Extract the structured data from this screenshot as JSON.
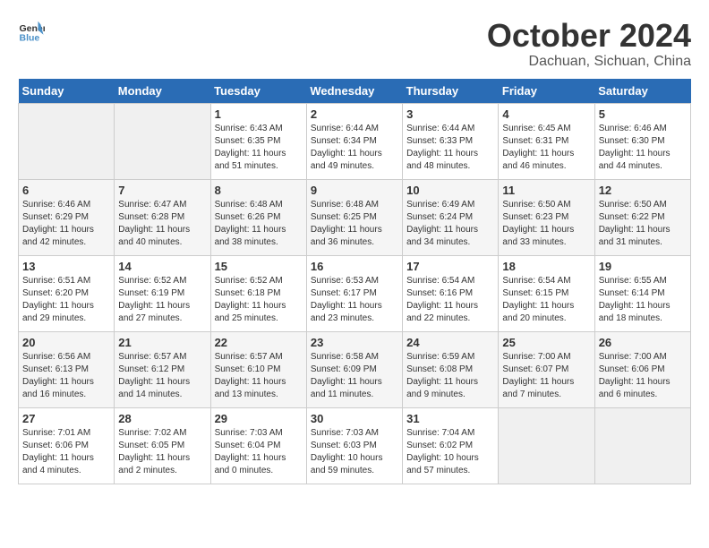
{
  "header": {
    "logo_line1": "General",
    "logo_line2": "Blue",
    "month_title": "October 2024",
    "location": "Dachuan, Sichuan, China"
  },
  "days_of_week": [
    "Sunday",
    "Monday",
    "Tuesday",
    "Wednesday",
    "Thursday",
    "Friday",
    "Saturday"
  ],
  "weeks": [
    [
      {
        "day": "",
        "info": ""
      },
      {
        "day": "",
        "info": ""
      },
      {
        "day": "1",
        "info": "Sunrise: 6:43 AM\nSunset: 6:35 PM\nDaylight: 11 hours and 51 minutes."
      },
      {
        "day": "2",
        "info": "Sunrise: 6:44 AM\nSunset: 6:34 PM\nDaylight: 11 hours and 49 minutes."
      },
      {
        "day": "3",
        "info": "Sunrise: 6:44 AM\nSunset: 6:33 PM\nDaylight: 11 hours and 48 minutes."
      },
      {
        "day": "4",
        "info": "Sunrise: 6:45 AM\nSunset: 6:31 PM\nDaylight: 11 hours and 46 minutes."
      },
      {
        "day": "5",
        "info": "Sunrise: 6:46 AM\nSunset: 6:30 PM\nDaylight: 11 hours and 44 minutes."
      }
    ],
    [
      {
        "day": "6",
        "info": "Sunrise: 6:46 AM\nSunset: 6:29 PM\nDaylight: 11 hours and 42 minutes."
      },
      {
        "day": "7",
        "info": "Sunrise: 6:47 AM\nSunset: 6:28 PM\nDaylight: 11 hours and 40 minutes."
      },
      {
        "day": "8",
        "info": "Sunrise: 6:48 AM\nSunset: 6:26 PM\nDaylight: 11 hours and 38 minutes."
      },
      {
        "day": "9",
        "info": "Sunrise: 6:48 AM\nSunset: 6:25 PM\nDaylight: 11 hours and 36 minutes."
      },
      {
        "day": "10",
        "info": "Sunrise: 6:49 AM\nSunset: 6:24 PM\nDaylight: 11 hours and 34 minutes."
      },
      {
        "day": "11",
        "info": "Sunrise: 6:50 AM\nSunset: 6:23 PM\nDaylight: 11 hours and 33 minutes."
      },
      {
        "day": "12",
        "info": "Sunrise: 6:50 AM\nSunset: 6:22 PM\nDaylight: 11 hours and 31 minutes."
      }
    ],
    [
      {
        "day": "13",
        "info": "Sunrise: 6:51 AM\nSunset: 6:20 PM\nDaylight: 11 hours and 29 minutes."
      },
      {
        "day": "14",
        "info": "Sunrise: 6:52 AM\nSunset: 6:19 PM\nDaylight: 11 hours and 27 minutes."
      },
      {
        "day": "15",
        "info": "Sunrise: 6:52 AM\nSunset: 6:18 PM\nDaylight: 11 hours and 25 minutes."
      },
      {
        "day": "16",
        "info": "Sunrise: 6:53 AM\nSunset: 6:17 PM\nDaylight: 11 hours and 23 minutes."
      },
      {
        "day": "17",
        "info": "Sunrise: 6:54 AM\nSunset: 6:16 PM\nDaylight: 11 hours and 22 minutes."
      },
      {
        "day": "18",
        "info": "Sunrise: 6:54 AM\nSunset: 6:15 PM\nDaylight: 11 hours and 20 minutes."
      },
      {
        "day": "19",
        "info": "Sunrise: 6:55 AM\nSunset: 6:14 PM\nDaylight: 11 hours and 18 minutes."
      }
    ],
    [
      {
        "day": "20",
        "info": "Sunrise: 6:56 AM\nSunset: 6:13 PM\nDaylight: 11 hours and 16 minutes."
      },
      {
        "day": "21",
        "info": "Sunrise: 6:57 AM\nSunset: 6:12 PM\nDaylight: 11 hours and 14 minutes."
      },
      {
        "day": "22",
        "info": "Sunrise: 6:57 AM\nSunset: 6:10 PM\nDaylight: 11 hours and 13 minutes."
      },
      {
        "day": "23",
        "info": "Sunrise: 6:58 AM\nSunset: 6:09 PM\nDaylight: 11 hours and 11 minutes."
      },
      {
        "day": "24",
        "info": "Sunrise: 6:59 AM\nSunset: 6:08 PM\nDaylight: 11 hours and 9 minutes."
      },
      {
        "day": "25",
        "info": "Sunrise: 7:00 AM\nSunset: 6:07 PM\nDaylight: 11 hours and 7 minutes."
      },
      {
        "day": "26",
        "info": "Sunrise: 7:00 AM\nSunset: 6:06 PM\nDaylight: 11 hours and 6 minutes."
      }
    ],
    [
      {
        "day": "27",
        "info": "Sunrise: 7:01 AM\nSunset: 6:06 PM\nDaylight: 11 hours and 4 minutes."
      },
      {
        "day": "28",
        "info": "Sunrise: 7:02 AM\nSunset: 6:05 PM\nDaylight: 11 hours and 2 minutes."
      },
      {
        "day": "29",
        "info": "Sunrise: 7:03 AM\nSunset: 6:04 PM\nDaylight: 11 hours and 0 minutes."
      },
      {
        "day": "30",
        "info": "Sunrise: 7:03 AM\nSunset: 6:03 PM\nDaylight: 10 hours and 59 minutes."
      },
      {
        "day": "31",
        "info": "Sunrise: 7:04 AM\nSunset: 6:02 PM\nDaylight: 10 hours and 57 minutes."
      },
      {
        "day": "",
        "info": ""
      },
      {
        "day": "",
        "info": ""
      }
    ]
  ]
}
